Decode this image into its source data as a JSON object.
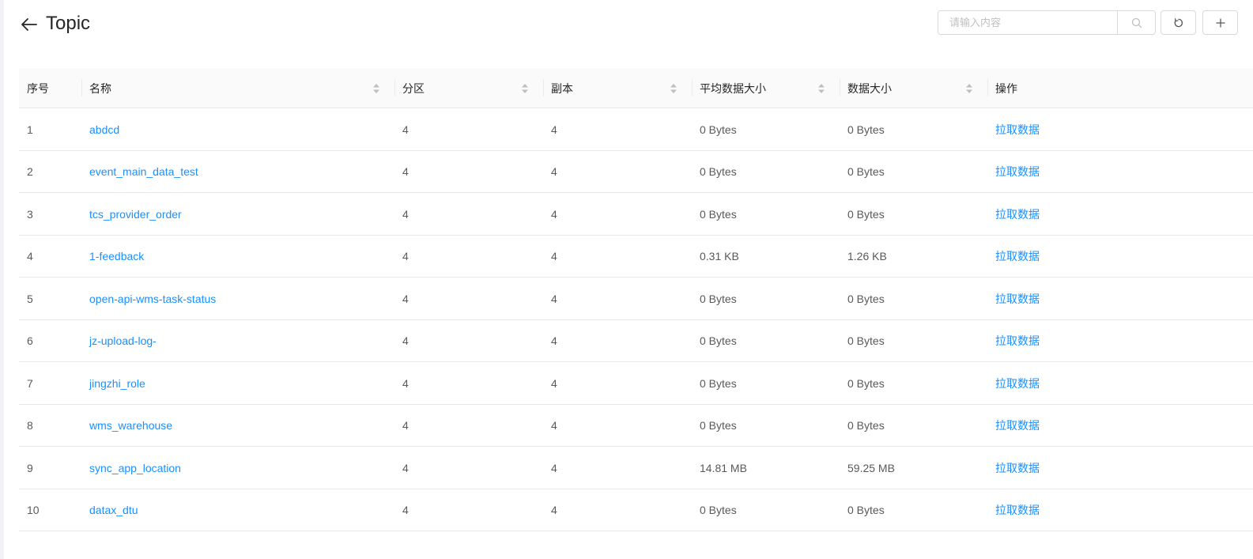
{
  "header": {
    "title": "Topic",
    "search_placeholder": "请输入内容",
    "search_value": ""
  },
  "icons": {
    "back": "arrow-left-icon",
    "search": "search-icon",
    "refresh": "refresh-icon",
    "add": "plus-icon"
  },
  "colors": {
    "link": "#1890ff",
    "header_bg": "#fafafa",
    "border": "#e8e8e8"
  },
  "table": {
    "columns": [
      "序号",
      "名称",
      "分区",
      "副本",
      "平均数据大小",
      "数据大小",
      "操作"
    ],
    "rows": [
      {
        "index": "1",
        "name": "abdcd",
        "partitions": "4",
        "replicas": "4",
        "avg_size": "0 Bytes",
        "size": "0 Bytes",
        "action": "拉取数据"
      },
      {
        "index": "2",
        "name": "event_main_data_test",
        "partitions": "4",
        "replicas": "4",
        "avg_size": "0 Bytes",
        "size": "0 Bytes",
        "action": "拉取数据"
      },
      {
        "index": "3",
        "name": "tcs_provider_order",
        "partitions": "4",
        "replicas": "4",
        "avg_size": "0 Bytes",
        "size": "0 Bytes",
        "action": "拉取数据"
      },
      {
        "index": "4",
        "name": "1-feedback",
        "partitions": "4",
        "replicas": "4",
        "avg_size": "0.31 KB",
        "size": "1.26 KB",
        "action": "拉取数据"
      },
      {
        "index": "5",
        "name": "open-api-wms-task-status",
        "partitions": "4",
        "replicas": "4",
        "avg_size": "0 Bytes",
        "size": "0 Bytes",
        "action": "拉取数据"
      },
      {
        "index": "6",
        "name": "jz-upload-log-",
        "partitions": "4",
        "replicas": "4",
        "avg_size": "0 Bytes",
        "size": "0 Bytes",
        "action": "拉取数据"
      },
      {
        "index": "7",
        "name": "jingzhi_role",
        "partitions": "4",
        "replicas": "4",
        "avg_size": "0 Bytes",
        "size": "0 Bytes",
        "action": "拉取数据"
      },
      {
        "index": "8",
        "name": "wms_warehouse",
        "partitions": "4",
        "replicas": "4",
        "avg_size": "0 Bytes",
        "size": "0 Bytes",
        "action": "拉取数据"
      },
      {
        "index": "9",
        "name": "sync_app_location",
        "partitions": "4",
        "replicas": "4",
        "avg_size": "14.81 MB",
        "size": "59.25 MB",
        "action": "拉取数据"
      },
      {
        "index": "10",
        "name": "datax_dtu",
        "partitions": "4",
        "replicas": "4",
        "avg_size": "0 Bytes",
        "size": "0 Bytes",
        "action": "拉取数据"
      }
    ]
  }
}
